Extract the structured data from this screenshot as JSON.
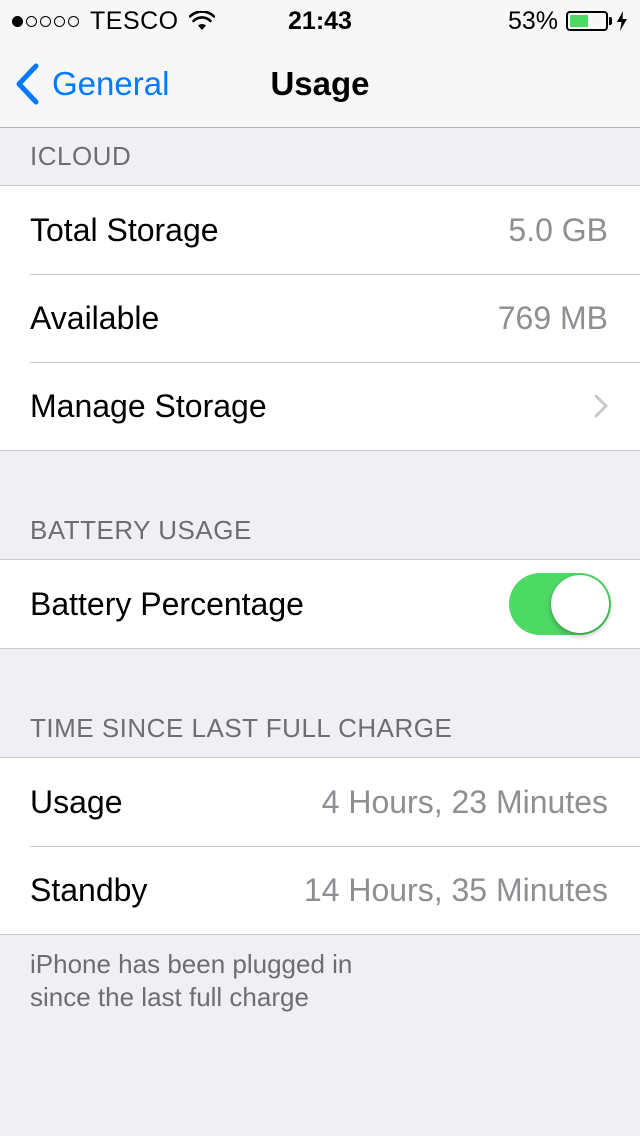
{
  "status_bar": {
    "carrier": "TESCO",
    "time": "21:43",
    "battery_percent_text": "53%",
    "battery_level": 0.53,
    "signal_strength": 1,
    "signal_max": 5,
    "charging": true
  },
  "nav": {
    "back_label": "General",
    "title": "Usage"
  },
  "icloud": {
    "header": "ICLOUD",
    "total_storage_label": "Total Storage",
    "total_storage_value": "5.0 GB",
    "available_label": "Available",
    "available_value": "769 MB",
    "manage_storage_label": "Manage Storage"
  },
  "battery_usage": {
    "header": "BATTERY USAGE",
    "percentage_label": "Battery Percentage",
    "percentage_on": true
  },
  "time_since_charge": {
    "header": "TIME SINCE LAST FULL CHARGE",
    "usage_label": "Usage",
    "usage_value": "4 Hours, 23 Minutes",
    "standby_label": "Standby",
    "standby_value": "14 Hours, 35 Minutes",
    "footer_line1": "iPhone has been plugged in",
    "footer_line2": "since the last full charge"
  },
  "colors": {
    "accent": "#007aff",
    "toggle_on": "#4cd964",
    "secondary_text": "#8e8e93",
    "section_header": "#6d6d72",
    "background": "#efeff4"
  }
}
